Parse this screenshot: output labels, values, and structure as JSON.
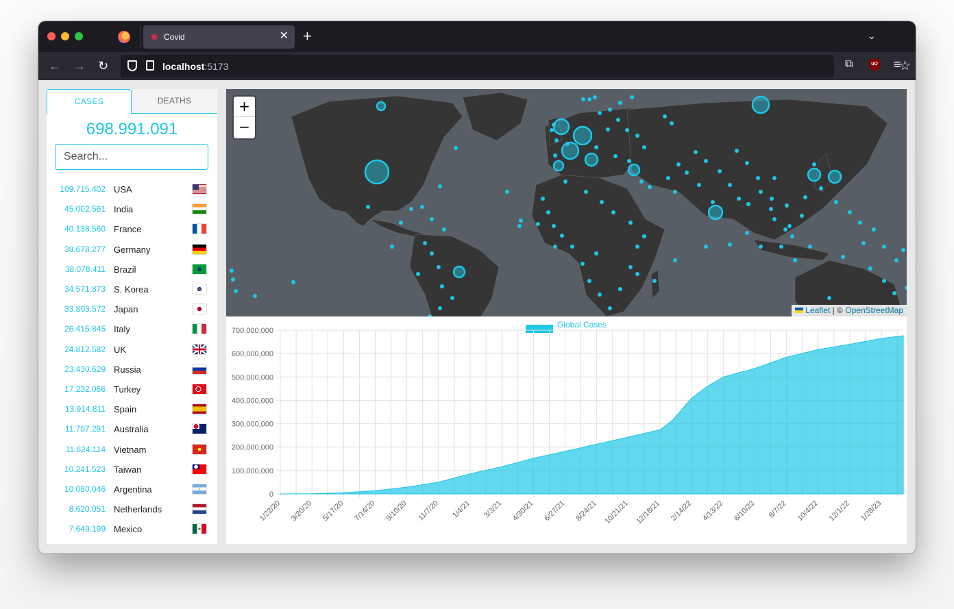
{
  "browser": {
    "tab_title": "Covid",
    "tab_favicon": "✺",
    "tab_close": "✕",
    "new_tab": "+",
    "tab_list": "⌄",
    "back": "←",
    "forward": "→",
    "reload": "↻",
    "url_host": "localhost",
    "url_port": ":5173",
    "bookmark": "☆",
    "extensions": "⧉",
    "ublock": "uO",
    "menu": "≡"
  },
  "sidebar": {
    "tab_cases": "CASES",
    "tab_deaths": "DEATHS",
    "total": "698.991.091",
    "search_placeholder": "Search...",
    "countries": [
      {
        "cases": "109.715.402",
        "name": "USA",
        "flag": "us"
      },
      {
        "cases": "45.002.561",
        "name": "India",
        "flag": "in"
      },
      {
        "cases": "40.138.560",
        "name": "France",
        "flag": "fr"
      },
      {
        "cases": "38.678.277",
        "name": "Germany",
        "flag": "de"
      },
      {
        "cases": "38.078.411",
        "name": "Brazil",
        "flag": "br"
      },
      {
        "cases": "34.571.873",
        "name": "S. Korea",
        "flag": "kr"
      },
      {
        "cases": "33.803.572",
        "name": "Japan",
        "flag": "jp"
      },
      {
        "cases": "26.415.845",
        "name": "Italy",
        "flag": "it"
      },
      {
        "cases": "24.812.582",
        "name": "UK",
        "flag": "gb"
      },
      {
        "cases": "23.430.629",
        "name": "Russia",
        "flag": "ru"
      },
      {
        "cases": "17.232.066",
        "name": "Turkey",
        "flag": "tr"
      },
      {
        "cases": "13.914.811",
        "name": "Spain",
        "flag": "es"
      },
      {
        "cases": "11.707.281",
        "name": "Australia",
        "flag": "au"
      },
      {
        "cases": "11.624.114",
        "name": "Vietnam",
        "flag": "vn"
      },
      {
        "cases": "10.241.523",
        "name": "Taiwan",
        "flag": "tw"
      },
      {
        "cases": "10.080.046",
        "name": "Argentina",
        "flag": "ar"
      },
      {
        "cases": "8.620.051",
        "name": "Netherlands",
        "flag": "nl"
      },
      {
        "cases": "7.649.199",
        "name": "Mexico",
        "flag": "mx"
      }
    ]
  },
  "map": {
    "zoom_in": "+",
    "zoom_out": "−",
    "attribution_leaflet": "Leaflet",
    "attribution_sep": " | © ",
    "attribution_osm": "OpenStreetMap",
    "colors": {
      "ocean": "#575e66",
      "land": "#353535",
      "marker": "#1ec7e6"
    }
  },
  "chart_data": {
    "type": "area",
    "legend": "Global Cases",
    "color": "#1ec7e6",
    "ylim": [
      0,
      700000000
    ],
    "yticks": [
      "0",
      "100,000,000",
      "200,000,000",
      "300,000,000",
      "400,000,000",
      "500,000,000",
      "600,000,000",
      "700,000,000"
    ],
    "xticks": [
      "1/22/20",
      "3/20/20",
      "5/17/20",
      "7/14/20",
      "9/10/20",
      "11/7/20",
      "1/4/21",
      "3/3/21",
      "4/30/21",
      "6/27/21",
      "8/24/21",
      "10/21/21",
      "12/18/21",
      "2/14/22",
      "4/13/22",
      "6/10/22",
      "8/7/22",
      "10/4/22",
      "12/1/22",
      "1/28/23"
    ],
    "x": [
      "1/22/20",
      "3/20/20",
      "5/17/20",
      "7/14/20",
      "9/10/20",
      "11/7/20",
      "1/4/21",
      "3/3/21",
      "4/30/21",
      "6/27/21",
      "8/24/21",
      "10/21/21",
      "12/18/21",
      "1/10/22",
      "2/14/22",
      "3/15/22",
      "4/13/22",
      "6/10/22",
      "8/7/22",
      "10/4/22",
      "12/1/22",
      "1/28/23",
      "3/9/23"
    ],
    "values": [
      0,
      1000000,
      5000000,
      14000000,
      29000000,
      50000000,
      86000000,
      116000000,
      153000000,
      182000000,
      213000000,
      243000000,
      274000000,
      315000000,
      410000000,
      460000000,
      500000000,
      537000000,
      585000000,
      617000000,
      640000000,
      665000000,
      676000000
    ]
  }
}
